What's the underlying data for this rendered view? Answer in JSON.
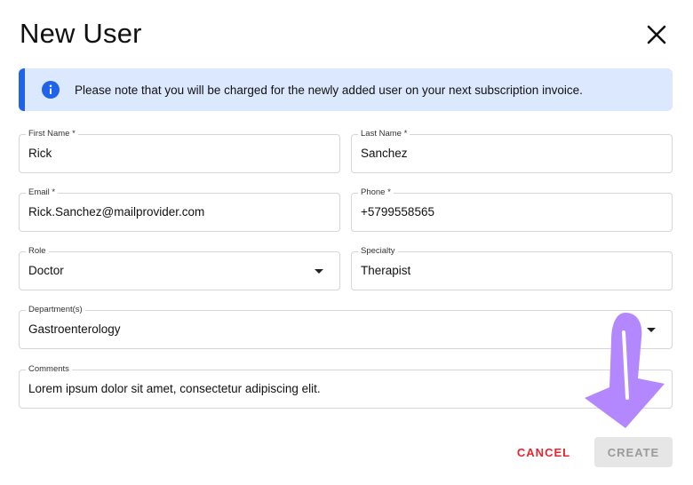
{
  "dialog": {
    "title": "New User",
    "close_icon": "close-icon"
  },
  "alert": {
    "icon": "info-icon",
    "text": "Please note that you will be charged for the newly added user on your next subscription invoice.",
    "accent_color": "#1e63e9",
    "background_color": "#dce8fd"
  },
  "form": {
    "first_name": {
      "label": "First Name *",
      "value": "Rick"
    },
    "last_name": {
      "label": "Last Name *",
      "value": "Sanchez"
    },
    "email": {
      "label": "Email *",
      "value": "Rick.Sanchez@mailprovider.com"
    },
    "phone": {
      "label": "Phone *",
      "value": "+5799558565"
    },
    "role": {
      "label": "Role",
      "value": "Doctor"
    },
    "specialty": {
      "label": "Specialty",
      "value": "Therapist"
    },
    "departments": {
      "label": "Department(s)",
      "value": "Gastroenterology"
    },
    "comments": {
      "label": "Comments",
      "value": "Lorem ipsum dolor sit amet, consectetur adipiscing elit."
    }
  },
  "actions": {
    "cancel_label": "CANCEL",
    "create_label": "CREATE",
    "cancel_color": "#e5262f"
  },
  "annotation": {
    "arrow_color": "#b388ff"
  }
}
